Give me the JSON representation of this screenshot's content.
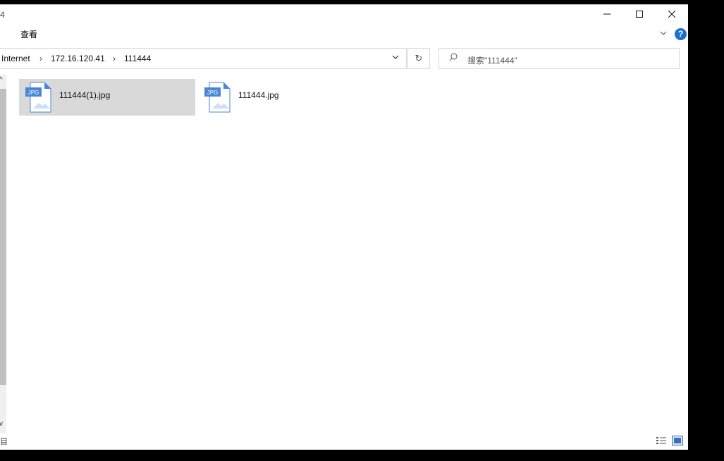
{
  "window": {
    "title_fragment": "4"
  },
  "controls": {
    "minimize": "minimize",
    "maximize": "maximize",
    "close": "close"
  },
  "ribbon": {
    "tab_view": "查看",
    "help": "?"
  },
  "address": {
    "crumbs": [
      "Internet",
      "172.16.120.41",
      "111444"
    ]
  },
  "search": {
    "placeholder": "搜索\"111444\""
  },
  "files": [
    {
      "name": "111444(1).jpg",
      "type": "JPG",
      "selected": true
    },
    {
      "name": "111444.jpg",
      "type": "JPG",
      "selected": false
    }
  ],
  "status": {
    "left_fragment": "目"
  },
  "colors": {
    "accent": "#1a6fd1",
    "selection": "#d9d9d9",
    "icon_blue": "#4a86d8"
  }
}
